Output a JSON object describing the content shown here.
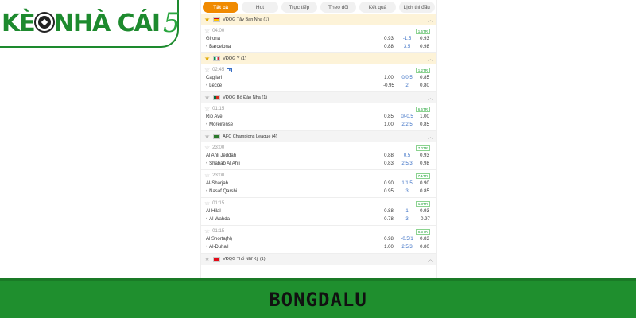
{
  "logo": {
    "text": "KÈ",
    "text2": "NHÀ CÁI",
    "num": "5"
  },
  "tabs": [
    {
      "label": "Tất cả",
      "active": true
    },
    {
      "label": "Hot",
      "active": false
    },
    {
      "label": "Trực tiếp",
      "active": false
    },
    {
      "label": "Theo dõi",
      "active": false
    },
    {
      "label": "Kết quả",
      "active": false
    },
    {
      "label": "Lịch thi đấu",
      "active": false
    }
  ],
  "leagues": [
    {
      "name": "VĐQG Tây Ban Nha (1)",
      "flag": "flag-es",
      "starred": true,
      "style": "",
      "matches": [
        {
          "time": "04:00",
          "badge": "1.5TR",
          "live": false,
          "home": {
            "name": "Girona",
            "o1": "0.93",
            "h": "-1.5",
            "o2": "0.93"
          },
          "away": {
            "name": "Barcelona",
            "o1": "0.88",
            "h": "3.5",
            "o2": "0.98"
          }
        }
      ]
    },
    {
      "name": "VĐQG Ý (1)",
      "flag": "flag-it",
      "starred": true,
      "style": "",
      "matches": [
        {
          "time": "02:45",
          "badge": "1.2TR",
          "live": true,
          "home": {
            "name": "Cagliari",
            "o1": "1.00",
            "h": "0/0.5",
            "o2": "0.85"
          },
          "away": {
            "name": "Lecce",
            "o1": "-0.95",
            "h": "2",
            "o2": "0.80"
          }
        }
      ]
    },
    {
      "name": "VĐQG Bồ Đào Nha (1)",
      "flag": "flag-pt",
      "starred": false,
      "style": "grey",
      "matches": [
        {
          "time": "01:15",
          "badge": "6.5TR",
          "live": false,
          "home": {
            "name": "Rio Ave",
            "o1": "0.85",
            "h": "0/-0.5",
            "o2": "1.00"
          },
          "away": {
            "name": "Moreirense",
            "o1": "1.00",
            "h": "2/2.5",
            "o2": "0.85"
          }
        }
      ]
    },
    {
      "name": "AFC Champions League (4)",
      "flag": "flag-afc",
      "starred": false,
      "style": "grey",
      "matches": [
        {
          "time": "23:00",
          "badge": "7.0TR",
          "live": false,
          "home": {
            "name": "Al Ahli Jeddah",
            "o1": "0.88",
            "h": "0.5",
            "o2": "0.93"
          },
          "away": {
            "name": "Shabab Al Ahli",
            "o1": "0.83",
            "h": "2.5/3",
            "o2": "0.98"
          }
        },
        {
          "time": "23:00",
          "badge": "7.1TR",
          "live": false,
          "home": {
            "name": "Al-Sharjah",
            "o1": "0.90",
            "h": "1/1.5",
            "o2": "0.90"
          },
          "away": {
            "name": "Nasaf Qarshi",
            "o1": "0.95",
            "h": "3",
            "o2": "0.85"
          }
        },
        {
          "time": "01:15",
          "badge": "1.3TR",
          "live": false,
          "home": {
            "name": "Al Hilal",
            "o1": "0.88",
            "h": "1",
            "o2": "0.93"
          },
          "away": {
            "name": "Al Wahda",
            "o1": "0.78",
            "h": "3",
            "o2": "-0.97"
          }
        },
        {
          "time": "01:15",
          "badge": "8.5TR",
          "live": false,
          "home": {
            "name": "Al Shorta(N)",
            "o1": "0.98",
            "h": "-0.5/1",
            "o2": "0.83"
          },
          "away": {
            "name": "Al-Duhail",
            "o1": "1.00",
            "h": "2.5/3",
            "o2": "0.80"
          }
        }
      ]
    },
    {
      "name": "VĐQG Thổ Nhĩ Kỳ (1)",
      "flag": "flag-tr",
      "starred": false,
      "style": "grey",
      "matches": []
    }
  ],
  "footer": {
    "text": "BONGDALU"
  },
  "colors": {
    "brand_green": "#1f8f2e",
    "tab_active": "#f08a00",
    "league_bg": "#fdf3d8",
    "handicap_blue": "#3a6fc4"
  }
}
